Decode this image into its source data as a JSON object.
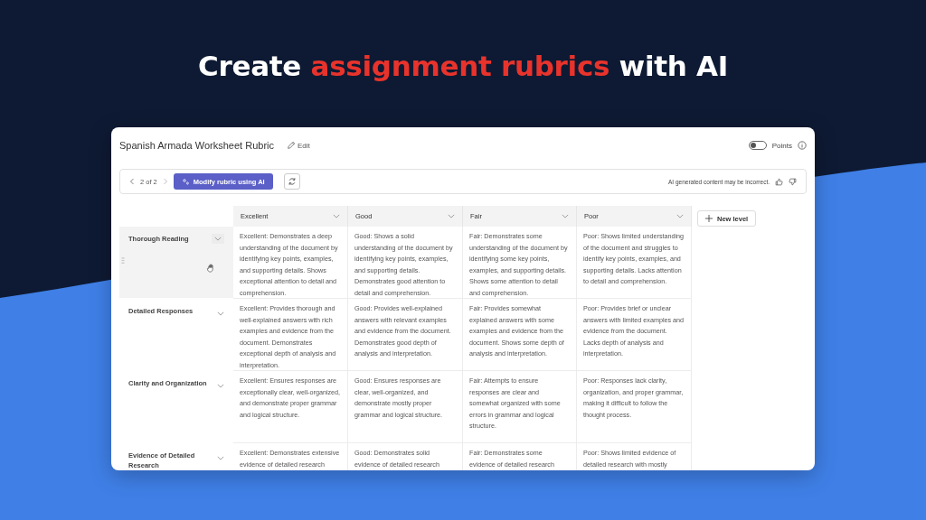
{
  "headline": [
    {
      "text": "Create ",
      "highlight": false
    },
    {
      "text": "assignment rubrics",
      "highlight": true
    },
    {
      "text": " with AI",
      "highlight": false
    }
  ],
  "rubric": {
    "title": "Spanish Armada Worksheet Rubric",
    "edit_label": "Edit",
    "points_toggle": {
      "label": "Points",
      "on": false
    },
    "toolbar": {
      "pager": "2 of 2",
      "modify_button": "Modify rubric using AI",
      "disclaimer": "AI generated content may be incorrect."
    },
    "levels": [
      "Excellent",
      "Good",
      "Fair",
      "Poor"
    ],
    "new_level_button": "New level",
    "criteria": [
      {
        "name": "Thorough Reading",
        "hovered": true,
        "cells": [
          "Excellent: Demonstrates a deep understanding of the document by identifying key points, examples, and supporting details. Shows exceptional attention to detail and comprehension.",
          "Good: Shows a solid understanding of the document by identifying key points, examples, and supporting details. Demonstrates good attention to detail and comprehension.",
          "Fair: Demonstrates some understanding of the document by identifying some key points, examples, and supporting details. Shows some attention to detail and comprehension.",
          "Poor: Shows limited understanding of the document and struggles to identify key points, examples, and supporting details. Lacks attention to detail and comprehension."
        ]
      },
      {
        "name": "Detailed Responses",
        "hovered": false,
        "cells": [
          "Excellent: Provides thorough and well-explained answers with rich examples and evidence from the document. Demonstrates exceptional depth of analysis and interpretation.",
          "Good: Provides well-explained answers with relevant examples and evidence from the document. Demonstrates good depth of analysis and interpretation.",
          "Fair: Provides somewhat explained answers with some examples and evidence from the document. Shows some depth of analysis and interpretation.",
          "Poor: Provides brief or unclear answers with limited examples and evidence from the document. Lacks depth of analysis and interpretation."
        ]
      },
      {
        "name": "Clarity and Organization",
        "hovered": false,
        "cells": [
          "Excellent: Ensures responses are exceptionally clear, well-organized, and demonstrate proper grammar and logical structure.",
          "Good: Ensures responses are clear, well-organized, and demonstrate mostly proper grammar and logical structure.",
          "Fair: Attempts to ensure responses are clear and somewhat organized with some errors in grammar and logical structure.",
          "Poor: Responses lack clarity, organization, and proper grammar, making it difficult to follow the thought process."
        ]
      },
      {
        "name": "Evidence of Detailed Research",
        "hovered": false,
        "cells": [
          "Excellent: Demonstrates extensive evidence of detailed research",
          "Good: Demonstrates solid evidence of detailed research",
          "Fair: Demonstrates some evidence of detailed research",
          "Poor: Shows limited evidence of detailed research with mostly"
        ]
      }
    ]
  }
}
